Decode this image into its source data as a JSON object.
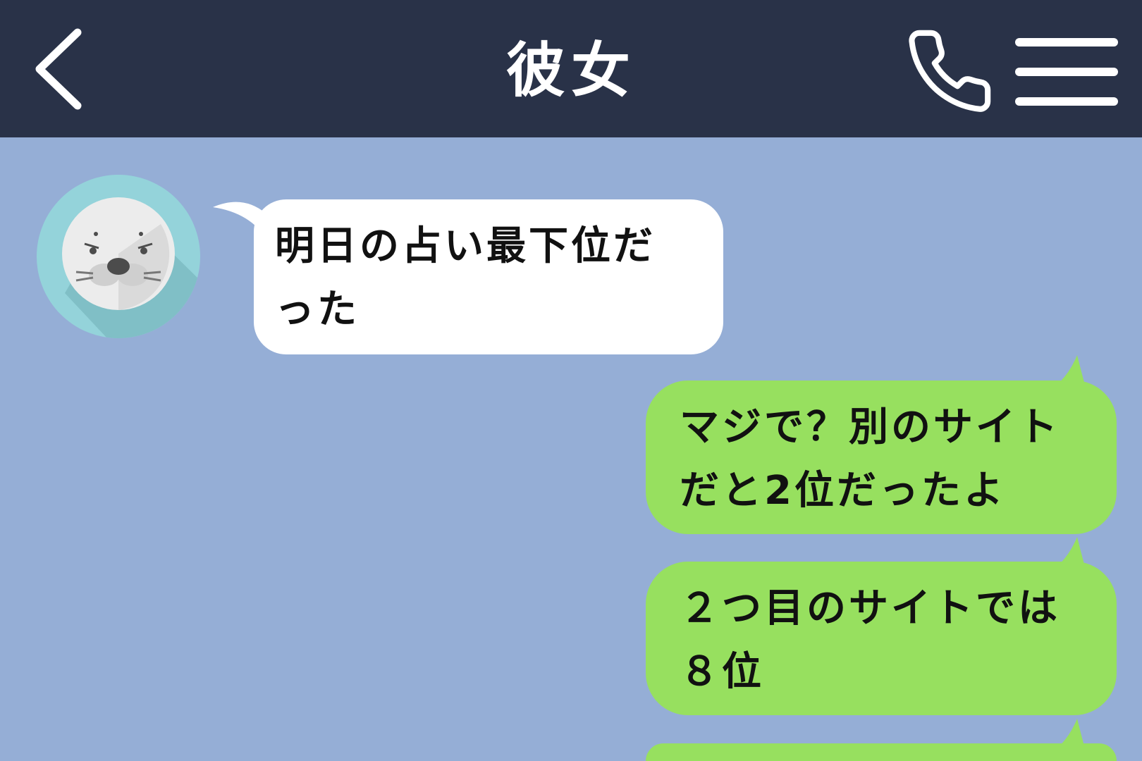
{
  "header": {
    "title": "彼女",
    "back_icon": "chevron-left-icon",
    "call_icon": "phone-icon",
    "menu_icon": "hamburger-menu-icon",
    "background": "#293248"
  },
  "chat": {
    "background": "#95aed6",
    "incoming_color": "#ffffff",
    "outgoing_color": "#97e05f",
    "messages": [
      {
        "from": "them",
        "text": "明日の占い最下位だ\nった"
      },
      {
        "from": "me",
        "text": "マジで？別のサイト\nだと2位だったよ"
      },
      {
        "from": "me",
        "text": "２つ目のサイトでは\n８位"
      },
      {
        "from": "me",
        "text": ""
      }
    ]
  }
}
